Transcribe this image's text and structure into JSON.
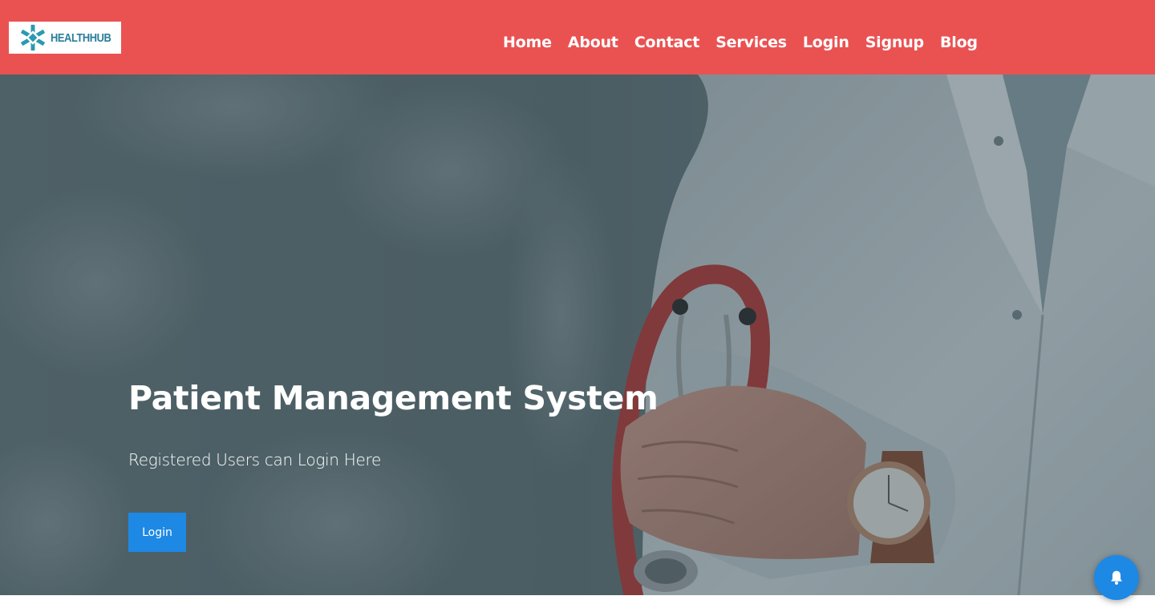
{
  "brand": {
    "logo_text": "HEALTHHUB",
    "logo_color": "#2a7d9a"
  },
  "header": {
    "background_color": "#ea5252",
    "nav": [
      {
        "label": "Home"
      },
      {
        "label": "About"
      },
      {
        "label": "Contact"
      },
      {
        "label": "Services"
      },
      {
        "label": "Login"
      },
      {
        "label": "Signup"
      },
      {
        "label": "Blog"
      }
    ]
  },
  "hero": {
    "title": "Patient Management System",
    "subtitle": "Registered Users can Login Here",
    "button_label": "Login",
    "button_color": "#1e88e5",
    "background_image": "doctor-with-stethoscope-photo"
  },
  "floating_action": {
    "icon": "bell-icon",
    "color": "#1e88e5"
  }
}
